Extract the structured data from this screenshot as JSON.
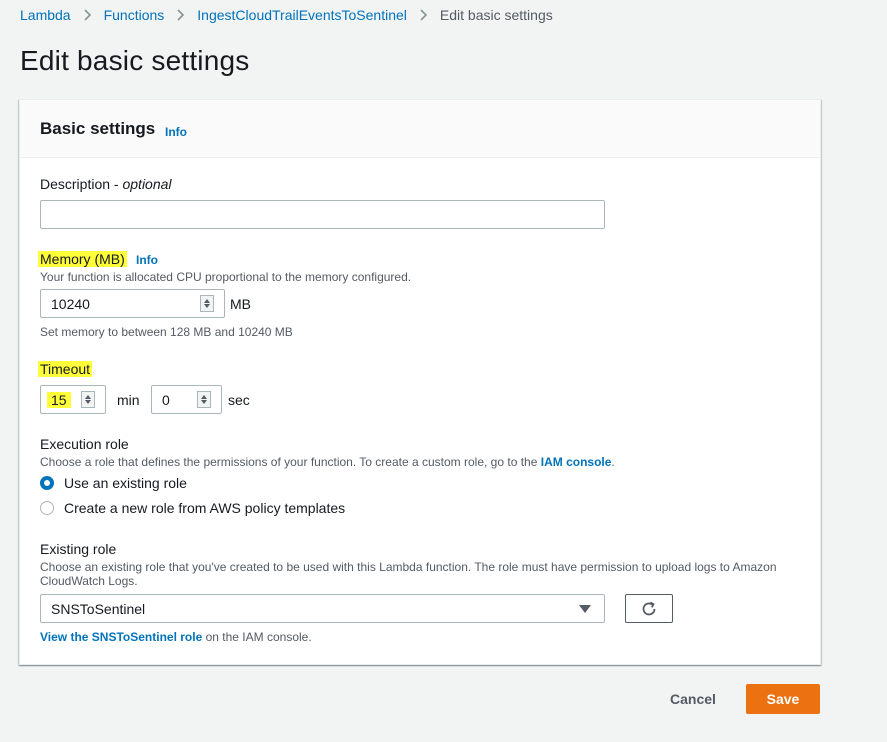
{
  "breadcrumb": {
    "items": [
      {
        "label": "Lambda"
      },
      {
        "label": "Functions"
      },
      {
        "label": "IngestCloudTrailEventsToSentinel"
      }
    ],
    "current": "Edit basic settings"
  },
  "page": {
    "title": "Edit basic settings"
  },
  "card": {
    "title": "Basic settings",
    "info": "Info"
  },
  "description": {
    "label": "Description",
    "optional": "optional",
    "separator": " - ",
    "value": ""
  },
  "memory": {
    "label": "Memory (MB)",
    "info": "Info",
    "help": "Your function is allocated CPU proportional to the memory configured.",
    "value": "10240",
    "unit": "MB",
    "constraint": "Set memory to between 128 MB and 10240 MB"
  },
  "timeout": {
    "label": "Timeout",
    "minutes": "15",
    "min_unit": "min",
    "seconds": "0",
    "sec_unit": "sec"
  },
  "execution_role": {
    "label": "Execution role",
    "help_prefix": "Choose a role that defines the permissions of your function. To create a custom role, go to the ",
    "help_link": "IAM console",
    "help_suffix": ".",
    "options": [
      {
        "label": "Use an existing role",
        "checked": true
      },
      {
        "label": "Create a new role from AWS policy templates",
        "checked": false
      }
    ]
  },
  "existing_role": {
    "label": "Existing role",
    "help_line1": "Choose an existing role that you've created to be used with this Lambda function. The role must have permission to upload logs to Amazon",
    "help_line2": "CloudWatch Logs.",
    "selected": "SNSToSentinel",
    "view_link": "View the SNSToSentinel role",
    "view_suffix": " on the IAM console."
  },
  "actions": {
    "cancel": "Cancel",
    "save": "Save"
  },
  "colors": {
    "link": "#0073bb",
    "primary": "#ec7211",
    "highlight": "#ffff3a"
  },
  "icons": {
    "breadcrumb_separator": "chevron-right-icon",
    "refresh": "refresh-icon",
    "dropdown": "caret-down-icon"
  }
}
